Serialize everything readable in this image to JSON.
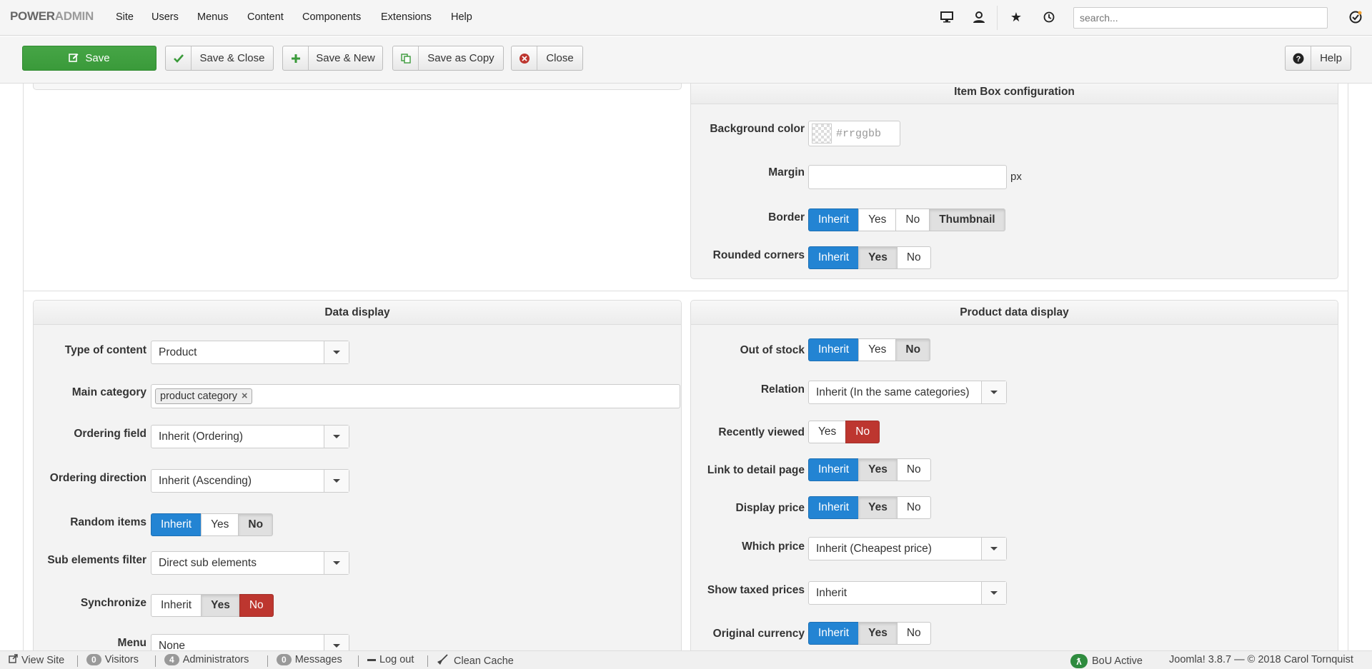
{
  "app": {
    "logo_a": "POWER",
    "logo_b": "ADMIN"
  },
  "nav": [
    "Site",
    "Users",
    "Menus",
    "Content",
    "Components",
    "Extensions",
    "Help"
  ],
  "search": {
    "placeholder": "search..."
  },
  "toolbar": {
    "save": "Save",
    "save_close": "Save & Close",
    "save_new": "Save & New",
    "save_copy": "Save as Copy",
    "close": "Close",
    "help": "Help"
  },
  "item_box": {
    "title": "Item Box configuration",
    "background_label": "Background color",
    "background_placeholder": "#rrggbb",
    "margin_label": "Margin",
    "margin_unit": "px",
    "border_label": "Border",
    "border_options": [
      "Inherit",
      "Yes",
      "No",
      "Thumbnail"
    ],
    "rounded_label": "Rounded corners",
    "rounded_options": [
      "Inherit",
      "Yes",
      "No"
    ]
  },
  "data_display": {
    "title": "Data display",
    "type_label": "Type of content",
    "type_value": "Product",
    "main_cat_label": "Main category",
    "main_cat_tag": "product category",
    "ordering_field_label": "Ordering field",
    "ordering_field_value": "Inherit (Ordering)",
    "ordering_dir_label": "Ordering direction",
    "ordering_dir_value": "Inherit (Ascending)",
    "random_label": "Random items",
    "random_options": [
      "Inherit",
      "Yes",
      "No"
    ],
    "sub_filter_label": "Sub elements filter",
    "sub_filter_value": "Direct sub elements",
    "sync_label": "Synchronize",
    "sync_options": [
      "Inherit",
      "Yes",
      "No"
    ],
    "menu_label": "Menu",
    "menu_value": "None"
  },
  "product_data": {
    "title": "Product data display",
    "out_of_stock_label": "Out of stock",
    "out_of_stock_options": [
      "Inherit",
      "Yes",
      "No"
    ],
    "relation_label": "Relation",
    "relation_value": "Inherit (In the same categories)",
    "recently_label": "Recently viewed",
    "recently_options": [
      "Yes",
      "No"
    ],
    "link_label": "Link to detail page",
    "link_options": [
      "Inherit",
      "Yes",
      "No"
    ],
    "display_price_label": "Display price",
    "display_price_options": [
      "Inherit",
      "Yes",
      "No"
    ],
    "which_price_label": "Which price",
    "which_price_value": "Inherit (Cheapest price)",
    "taxed_label": "Show taxed prices",
    "taxed_value": "Inherit",
    "currency_label": "Original currency",
    "currency_options": [
      "Inherit",
      "Yes",
      "No"
    ]
  },
  "footer": {
    "view_site": "View Site",
    "visitors_count": "0",
    "visitors": "Visitors",
    "admins_count": "4",
    "admins": "Administrators",
    "messages_count": "0",
    "messages": "Messages",
    "logout": "Log out",
    "clean_cache": "Clean Cache",
    "bou": "BoU Active",
    "version": "Joomla! 3.8.7 — © 2018 Carol Tornquist"
  },
  "colors": {
    "accent_blue": "#2384d3",
    "danger_red": "#bd362f",
    "save_green": "#46a546"
  }
}
